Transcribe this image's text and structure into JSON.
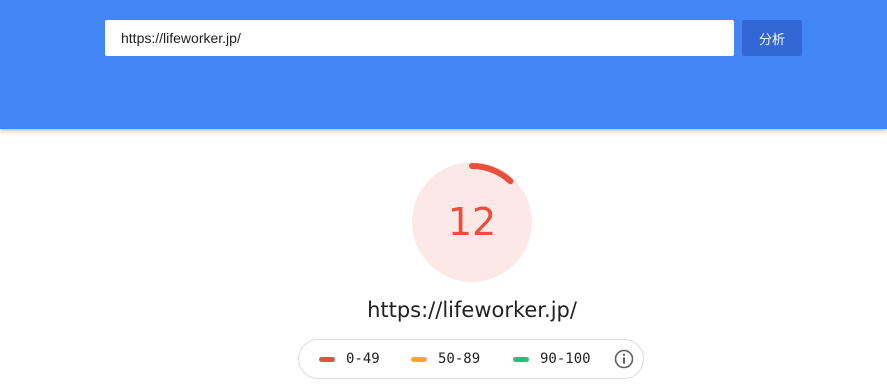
{
  "search": {
    "url_value": "https://lifeworker.jp/",
    "analyze_label": "分析"
  },
  "report": {
    "score": "12",
    "score_fraction": 0.12,
    "page_url": "https://lifeworker.jp/"
  },
  "legend": {
    "items": [
      {
        "label": "0-49",
        "color": "#eb4e3d"
      },
      {
        "label": "50-89",
        "color": "#f9a825"
      },
      {
        "label": "90-100",
        "color": "#1fc47a"
      }
    ],
    "info_icon": "info-icon"
  },
  "colors": {
    "header_bg": "#4285f4",
    "button_bg": "#3367d6",
    "score_fail": "#eb4e3d",
    "gauge_bg": "#fce8e6"
  }
}
